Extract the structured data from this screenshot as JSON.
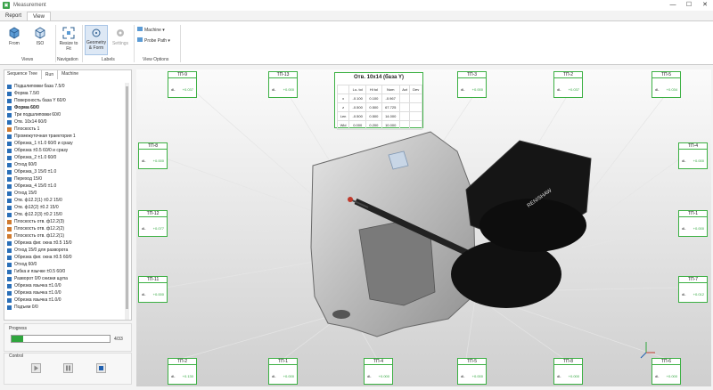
{
  "window": {
    "title": "Measurement",
    "minimize": "—",
    "maximize": "☐",
    "close": "✕"
  },
  "menu": {
    "tabs": [
      {
        "label": "Report"
      },
      {
        "label": "View"
      }
    ]
  },
  "ribbon": {
    "from": "From",
    "iso": "ISO",
    "views": "Views",
    "resize": "Resize to Fit",
    "navigation": "Navigation",
    "geom": "Geometry & Form",
    "settings": "Settings",
    "labels": "Labels",
    "machine": "Machine",
    "probe_path": "Probe Path",
    "view_options": "View Options"
  },
  "panel": {
    "tabs": [
      {
        "label": "Sequence Tree"
      },
      {
        "label": "Run"
      },
      {
        "label": "Machine"
      }
    ]
  },
  "sequence": [
    "Подшлиповки база 7.5/0",
    "Форма 7.5/0",
    "Поверхность база Y 60/0",
    "Форма 60/0",
    "Три подшлиповки 60/0",
    "Отв. 10x14 60/0",
    "Плоскость 1",
    "Промежуточная траектория 1",
    "Обрезка_1 ±1.0 60/0 и сразу",
    "Обрезка ±0.5 60/0 и сразу",
    "Обрезка_2 ±1.0 60/0",
    "Отход 60/0",
    "Обрезка_3 15/0 ±1.0",
    "Переход 15/0",
    "Обрезка_4 15/0 ±1.0",
    "Отход 15/0",
    "Отв. ф12.2(1) ±0.2 15/0",
    "Отв. ф12(2) ±0.2 15/0",
    "Отв. ф12.2(3) ±0.2 15/0",
    "Плоскость отв. ф12.2(3)",
    "Плоскость отв. ф12.2(2)",
    "Плоскость отв. ф12.2(1)",
    "Обрезка фиг. окна ±0.5 15/0",
    "Отход 15/0 для разворота",
    "Обрезка фиг. окна ±0.5 60/0",
    "Отход 60/0",
    "Гибка и язычке ±0.5 60/0",
    "Разворот 0/0 снизки щупа",
    "Обрезка язычка ±1.0/0",
    "Обрезка язычка ±1.0/0",
    "Обрезка язычка ±1.0/0",
    "Подъем 0/0"
  ],
  "progress": {
    "title": "Progress",
    "text": "4/33",
    "value": 0.12
  },
  "control": {
    "title": "Control"
  },
  "colors": {
    "accent": "#3cb043",
    "header_blue": "#1e6fc6"
  },
  "table": {
    "title": "Отв. 10x14 (база Y)",
    "header": [
      "",
      "Lo- tol",
      "Hi tol",
      "Nom",
      "Act",
      "Dev"
    ],
    "rows": [
      [
        "x",
        "-0.100",
        "0.100",
        "-0.967",
        "",
        ""
      ],
      [
        "z",
        "-0.500",
        "0.500",
        "67.725",
        "",
        ""
      ],
      [
        "Len",
        "-0.500",
        "0.500",
        "14.000",
        "",
        ""
      ],
      [
        "Wid",
        "0.000",
        "0.200",
        "10.000",
        "",
        ""
      ]
    ]
  },
  "tags": [
    {
      "name": "ТП-9",
      "label": "dL",
      "value": "+0.037"
    },
    {
      "name": "ТП-13",
      "label": "dL",
      "value": "+0.000"
    },
    {
      "name": "ТП-3",
      "label": "dL",
      "value": "+0.000"
    },
    {
      "name": "ТП-2",
      "label": "dL",
      "value": "+0.037"
    },
    {
      "name": "ТП-5",
      "label": "dL",
      "value": "+0.034"
    },
    {
      "name": "ТП-8",
      "label": "dL",
      "value": "+0.000"
    },
    {
      "name": "ТП-4",
      "label": "dL",
      "value": "+0.000"
    },
    {
      "name": "ТП-12",
      "label": "dL",
      "value": "+0.077"
    },
    {
      "name": "ТП-1",
      "label": "dL",
      "value": "+0.000"
    },
    {
      "name": "ТП-11",
      "label": "dL",
      "value": "+0.000"
    },
    {
      "name": "ТП-7",
      "label": "dL",
      "value": "+0.012"
    },
    {
      "name": "ТП-2",
      "label": "dL",
      "value": "+0.130"
    },
    {
      "name": "ТП-1",
      "label": "dL",
      "value": "+0.000"
    },
    {
      "name": "ТП-4",
      "label": "dL",
      "value": "+0.000"
    },
    {
      "name": "ТП-5",
      "label": "dL",
      "value": "+0.000"
    },
    {
      "name": "ТП-8",
      "label": "dL",
      "value": "+0.000"
    },
    {
      "name": "ТП-6",
      "label": "dL",
      "value": "+0.000"
    }
  ]
}
